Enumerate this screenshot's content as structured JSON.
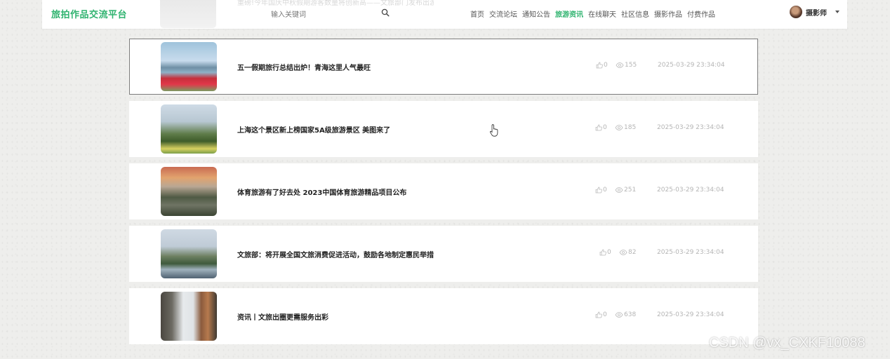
{
  "header": {
    "logo": "旅拍作品交流平台",
    "ghost_text": "重磅!今年国庆中秋假期游客数量将创新高——文旅部门发布出游提示",
    "search": {
      "placeholder": "输入关键词"
    },
    "nav": [
      {
        "label": "首页",
        "active": false
      },
      {
        "label": "交流论坛",
        "active": false
      },
      {
        "label": "通知公告",
        "active": false
      },
      {
        "label": "旅游资讯",
        "active": true
      },
      {
        "label": "在线聊天",
        "active": false
      },
      {
        "label": "社区信息",
        "active": false
      },
      {
        "label": "摄影作品",
        "active": false
      },
      {
        "label": "付费作品",
        "active": false
      }
    ],
    "user": {
      "name": "摄影师"
    }
  },
  "articles": [
    {
      "title": "五一假期旅行总结出炉！青海这里人气最旺",
      "likes": "0",
      "views": "155",
      "date": "2025-03-29 23:34:04",
      "selected": true
    },
    {
      "title": "上海这个景区新上榜国家5A级旅游景区 美图来了",
      "likes": "0",
      "views": "185",
      "date": "2025-03-29 23:34:04",
      "selected": false
    },
    {
      "title": "体育旅游有了好去处 2023中国体育旅游精品项目公布",
      "likes": "0",
      "views": "251",
      "date": "2025-03-29 23:34:04",
      "selected": false
    },
    {
      "title": "文旅部：将开展全国文旅消费促进活动，鼓励各地制定惠民举措",
      "likes": "0",
      "views": "82",
      "date": "2025-03-29 23:34:04",
      "selected": false
    },
    {
      "title": "资讯丨文旅出圈更需服务出彩",
      "likes": "0",
      "views": "638",
      "date": "2025-03-29 23:34:04",
      "selected": false
    }
  ],
  "watermark": "CSDN @vx_CXKF10088",
  "colors": {
    "accent": "#2fb36f",
    "meta": "#b5b5b5"
  }
}
